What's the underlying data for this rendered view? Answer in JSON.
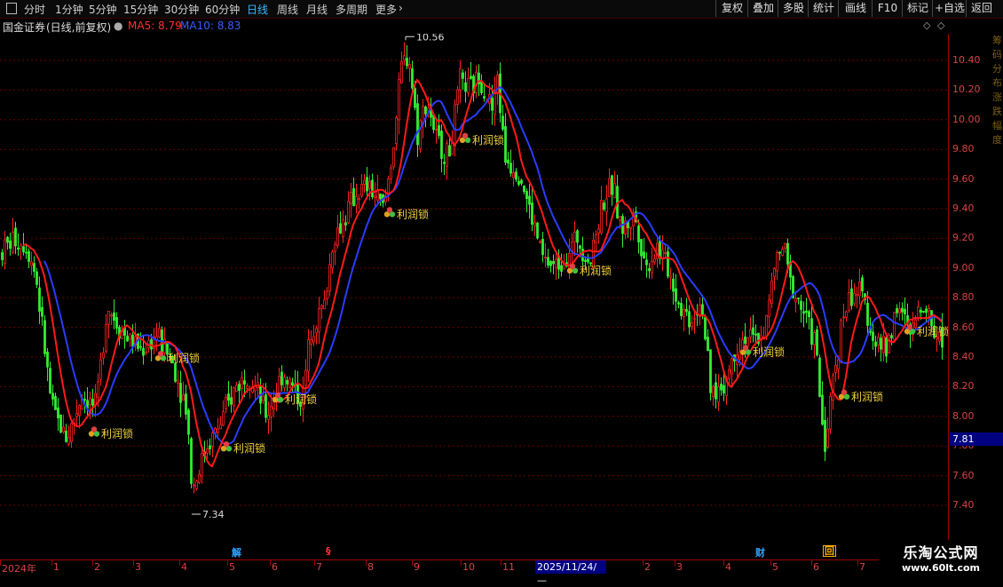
{
  "toolbar": {
    "periods": [
      "分时",
      "1分钟",
      "5分钟",
      "15分钟",
      "30分钟",
      "60分钟",
      "日线",
      "周线",
      "月线",
      "多周期",
      "更多"
    ],
    "active_period": "日线",
    "right_buttons": [
      "复权",
      "叠加",
      "多股",
      "统计",
      "画线",
      "F10",
      "标记",
      "+自选",
      "返回"
    ]
  },
  "info": {
    "stock_name": "国金证券",
    "mode": "(日线,前复权)",
    "ma5_text": "MA5: 8.79",
    "ma10_text": "MA10: 8.83"
  },
  "colors": {
    "up": "#ff2020",
    "down": "#33ee33",
    "ma5": "#ff1a1a",
    "ma10": "#2a3cff",
    "grid": "#6a0000",
    "axis": "#d84444"
  },
  "price_scale": [
    10.4,
    10.2,
    10.0,
    9.8,
    9.6,
    9.4,
    9.2,
    9.0,
    8.8,
    8.6,
    8.4,
    8.2,
    8.0,
    7.8,
    7.6,
    7.4
  ],
  "current_price": "7.81",
  "high_label": "10.56",
  "low_label": "7.34",
  "signal_label": "利润锁",
  "month_labels": [
    "2024年",
    "1",
    "2",
    "3",
    "4",
    "5",
    "6",
    "7",
    "8",
    "9",
    "10",
    "11",
    "2",
    "3",
    "4",
    "5",
    "6",
    "7"
  ],
  "cursor_date": "2025/11/24/—",
  "events": [
    {
      "text": "解",
      "color": "#33a4ff"
    },
    {
      "text": "§",
      "color": "#ff3333"
    },
    {
      "text": "财",
      "color": "#33a4ff"
    },
    {
      "text": "回",
      "color": "#ffb000"
    }
  ],
  "watermark": {
    "line1": "乐淘公式网",
    "line2": "www.60lt.com"
  },
  "right_edge_text": "筹码分布涨跌幅度",
  "chart_data": {
    "type": "candlestick",
    "ylim": [
      7.23,
      10.78
    ],
    "anchors": [
      [
        0,
        9.1
      ],
      [
        15,
        9.2
      ],
      [
        30,
        9.15
      ],
      [
        40,
        8.95
      ],
      [
        58,
        8.05
      ],
      [
        75,
        7.85
      ],
      [
        92,
        8.15
      ],
      [
        108,
        8.05
      ],
      [
        120,
        8.75
      ],
      [
        140,
        8.55
      ],
      [
        160,
        8.45
      ],
      [
        176,
        8.55
      ],
      [
        195,
        8.35
      ],
      [
        210,
        8.05
      ],
      [
        216,
        7.5
      ],
      [
        232,
        7.8
      ],
      [
        248,
        7.95
      ],
      [
        265,
        8.2
      ],
      [
        280,
        8.3
      ],
      [
        300,
        8.0
      ],
      [
        318,
        8.3
      ],
      [
        340,
        8.1
      ],
      [
        350,
        8.6
      ],
      [
        365,
        8.75
      ],
      [
        375,
        9.2
      ],
      [
        385,
        9.3
      ],
      [
        400,
        9.5
      ],
      [
        415,
        9.55
      ],
      [
        432,
        9.4
      ],
      [
        442,
        9.8
      ],
      [
        452,
        10.35
      ],
      [
        460,
        10.45
      ],
      [
        470,
        9.9
      ],
      [
        480,
        10.15
      ],
      [
        492,
        9.85
      ],
      [
        505,
        9.75
      ],
      [
        518,
        10.25
      ],
      [
        530,
        10.2
      ],
      [
        540,
        10.3
      ],
      [
        555,
        10.05
      ],
      [
        560,
        10.3
      ],
      [
        568,
        9.75
      ],
      [
        585,
        9.65
      ],
      [
        598,
        9.35
      ],
      [
        612,
        9.05
      ],
      [
        625,
        9.0
      ],
      [
        638,
        9.1
      ],
      [
        650,
        9.2
      ],
      [
        665,
        9.05
      ],
      [
        678,
        9.45
      ],
      [
        690,
        9.55
      ],
      [
        700,
        9.25
      ],
      [
        715,
        9.35
      ],
      [
        728,
        9.0
      ],
      [
        740,
        9.15
      ],
      [
        752,
        9.0
      ],
      [
        765,
        8.75
      ],
      [
        778,
        8.65
      ],
      [
        790,
        8.8
      ],
      [
        800,
        8.15
      ],
      [
        815,
        8.2
      ],
      [
        828,
        8.45
      ],
      [
        840,
        8.55
      ],
      [
        850,
        8.5
      ],
      [
        862,
        8.6
      ],
      [
        872,
        9.0
      ],
      [
        882,
        9.15
      ],
      [
        890,
        8.9
      ],
      [
        905,
        8.7
      ],
      [
        918,
        8.5
      ],
      [
        925,
        8.0
      ],
      [
        930,
        7.8
      ],
      [
        938,
        8.25
      ],
      [
        950,
        8.7
      ],
      [
        962,
        8.85
      ],
      [
        972,
        8.8
      ],
      [
        985,
        8.5
      ],
      [
        998,
        8.45
      ],
      [
        1010,
        8.75
      ],
      [
        1025,
        8.55
      ],
      [
        1040,
        8.8
      ],
      [
        1050,
        8.6
      ],
      [
        1062,
        8.5
      ]
    ],
    "lock_signals": [
      {
        "x": 106,
        "price": 7.9
      },
      {
        "x": 181,
        "price": 8.41
      },
      {
        "x": 255,
        "price": 7.8
      },
      {
        "x": 313,
        "price": 8.13
      },
      {
        "x": 439,
        "price": 9.38
      },
      {
        "x": 524,
        "price": 9.88
      },
      {
        "x": 645,
        "price": 9.0
      },
      {
        "x": 840,
        "price": 8.45
      },
      {
        "x": 951,
        "price": 8.15
      },
      {
        "x": 1025,
        "price": 8.59
      }
    ],
    "high_point": {
      "x": 457,
      "price": 10.56
    },
    "low_point": {
      "x": 216,
      "price": 7.34
    }
  }
}
